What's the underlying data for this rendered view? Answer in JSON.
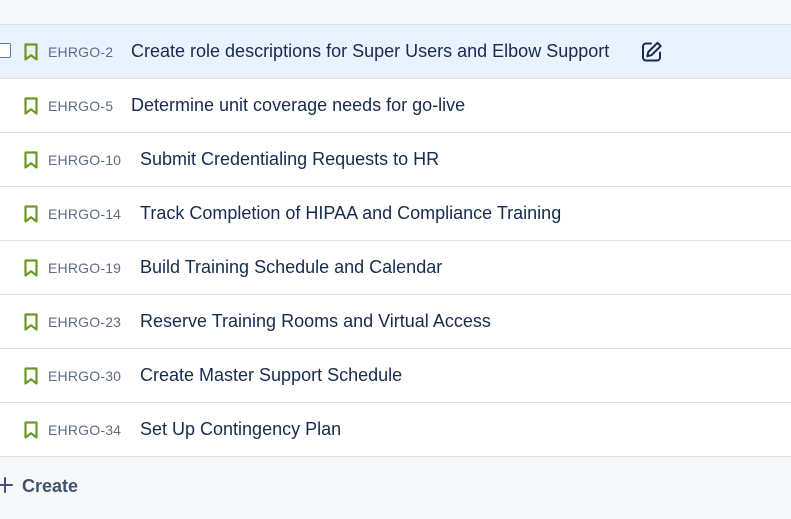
{
  "issues": [
    {
      "key": "EHRGO-2",
      "summary": "Create role descriptions for Super Users and Elbow Support",
      "selected": true
    },
    {
      "key": "EHRGO-5",
      "summary": "Determine unit coverage needs for go-live",
      "selected": false
    },
    {
      "key": "EHRGO-10",
      "summary": "Submit Credentialing Requests to HR",
      "selected": false
    },
    {
      "key": "EHRGO-14",
      "summary": "Track Completion of HIPAA and Compliance Training",
      "selected": false
    },
    {
      "key": "EHRGO-19",
      "summary": "Build Training Schedule and Calendar",
      "selected": false
    },
    {
      "key": "EHRGO-23",
      "summary": "Reserve Training Rooms and Virtual Access",
      "selected": false
    },
    {
      "key": "EHRGO-30",
      "summary": "Create Master Support Schedule",
      "selected": false
    },
    {
      "key": "EHRGO-34",
      "summary": "Set Up Contingency Plan",
      "selected": false
    }
  ],
  "icons": {
    "issue_type": "story-bookmark-icon",
    "edit": "edit-pencil-icon",
    "create": "plus-icon",
    "select": "checkbox"
  },
  "colors": {
    "story_icon": "#6a9a23",
    "selected_row": "#e9f2ff",
    "key_text": "#5e6c84",
    "summary_text": "#172b4d"
  },
  "footer": {
    "create_label": "Create"
  }
}
